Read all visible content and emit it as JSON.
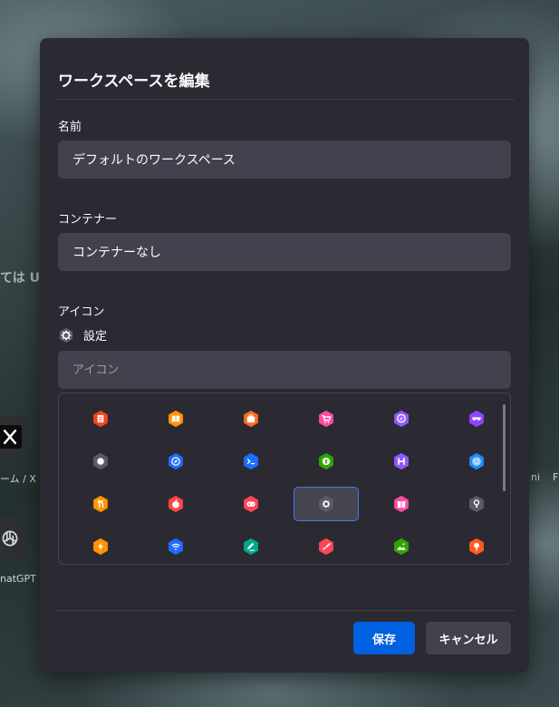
{
  "background": {
    "url_hint": "ては UR",
    "tiles": [
      {
        "label": "ーム / X",
        "icon": "x-logo"
      },
      {
        "label": "natGPT",
        "icon": "chatgpt-logo"
      }
    ],
    "right_labels": [
      "ni",
      "F"
    ]
  },
  "dialog": {
    "title": "ワークスペースを編集",
    "name": {
      "label": "名前",
      "value": "デフォルトのワークスペース"
    },
    "container": {
      "label": "コンテナー",
      "value": "コンテナーなし"
    },
    "icon": {
      "label": "アイコン",
      "selected_name": "設定",
      "selected_icon": "gear-icon",
      "search_placeholder": "アイコン"
    },
    "icons": [
      {
        "name": "fingerprint-document-icon",
        "color": "#f5441b"
      },
      {
        "name": "book-icon",
        "color": "#ff9400"
      },
      {
        "name": "briefcase-icon",
        "color": "#ff6a1f"
      },
      {
        "name": "cart-icon",
        "color": "#ff4aa2"
      },
      {
        "name": "chat-icon",
        "color": "#9059ff"
      },
      {
        "name": "mask-icon",
        "color": "#8b44ff"
      },
      {
        "name": "circle-icon",
        "color": "#5b5b66"
      },
      {
        "name": "compass-icon",
        "color": "#1d6dff"
      },
      {
        "name": "terminal-icon",
        "color": "#1d6dff"
      },
      {
        "name": "dollar-icon",
        "color": "#2fa600"
      },
      {
        "name": "film-icon",
        "color": "#9059ff"
      },
      {
        "name": "fingerprint-icon",
        "color": "#1d8bff"
      },
      {
        "name": "food-icon",
        "color": "#ff9400"
      },
      {
        "name": "fruit-icon",
        "color": "#ff4545"
      },
      {
        "name": "gamepad-icon",
        "color": "#ff4555"
      },
      {
        "name": "gear-icon",
        "color": "#5b5b66"
      },
      {
        "name": "gift-icon",
        "color": "#ff4aa2"
      },
      {
        "name": "key-icon",
        "color": "#5b5b66"
      },
      {
        "name": "lightning-icon",
        "color": "#ff9400"
      },
      {
        "name": "wifi-icon",
        "color": "#1d6dff"
      },
      {
        "name": "pen-icon",
        "color": "#00a88c"
      },
      {
        "name": "paintbrush-icon",
        "color": "#ff4555"
      },
      {
        "name": "landscape-icon",
        "color": "#2fa600"
      },
      {
        "name": "pin-icon",
        "color": "#ff5a1f"
      }
    ],
    "selected_index": 15,
    "save_label": "保存",
    "cancel_label": "キャンセル"
  },
  "colors": {
    "accent": "#0061e0",
    "dialog_bg": "#2b2a33",
    "field_bg": "#42414d"
  }
}
